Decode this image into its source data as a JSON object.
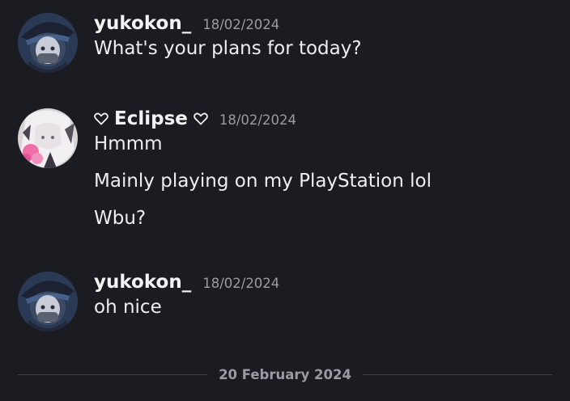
{
  "messages": [
    {
      "author": "yukokon_",
      "timestamp": "18/02/2024",
      "avatar_icon": "anime-avatar-dark-hat",
      "lines": [
        "What's your plans for today?"
      ]
    },
    {
      "author": "Eclipse",
      "author_decor": "heart-outline",
      "timestamp": "18/02/2024",
      "avatar_icon": "anime-avatar-white-hair",
      "lines": [
        "Hmmm",
        "Mainly playing on my PlayStation lol",
        "Wbu?"
      ]
    },
    {
      "author": "yukokon_",
      "timestamp": "18/02/2024",
      "avatar_icon": "anime-avatar-dark-hat",
      "lines": [
        "oh nice"
      ]
    }
  ],
  "date_divider": "20 February 2024",
  "colors": {
    "background": "#1b1c21",
    "text": "#eceef2",
    "muted": "#9a9ca4",
    "divider": "#3f4148"
  }
}
